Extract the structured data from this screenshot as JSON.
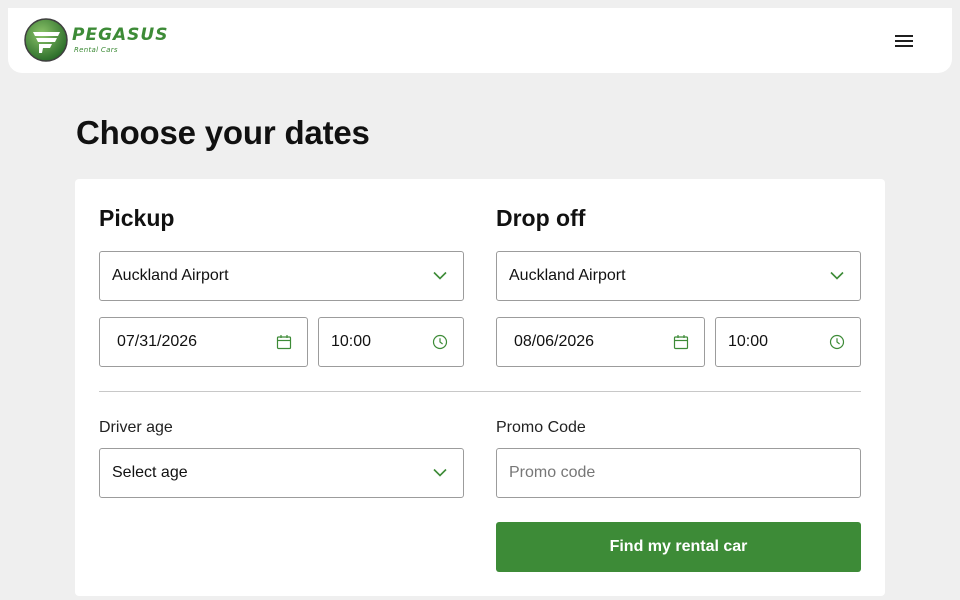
{
  "header": {
    "brand": "PEGASUS",
    "brand_sub": "Rental Cars",
    "menu_icon": "hamburger-icon"
  },
  "page": {
    "title": "Choose your dates"
  },
  "pickup": {
    "title": "Pickup",
    "location": "Auckland Airport",
    "date": "07/31/2026",
    "time": "10:00"
  },
  "dropoff": {
    "title": "Drop off",
    "location": "Auckland Airport",
    "date": "08/06/2026",
    "time": "10:00"
  },
  "driver": {
    "label": "Driver age",
    "value": "Select age"
  },
  "promo": {
    "label": "Promo Code",
    "placeholder": "Promo code"
  },
  "cta": {
    "label": "Find my rental car"
  },
  "colors": {
    "brand_green": "#3d8b37",
    "icon_green": "#3d8b37",
    "background": "#efefef"
  }
}
